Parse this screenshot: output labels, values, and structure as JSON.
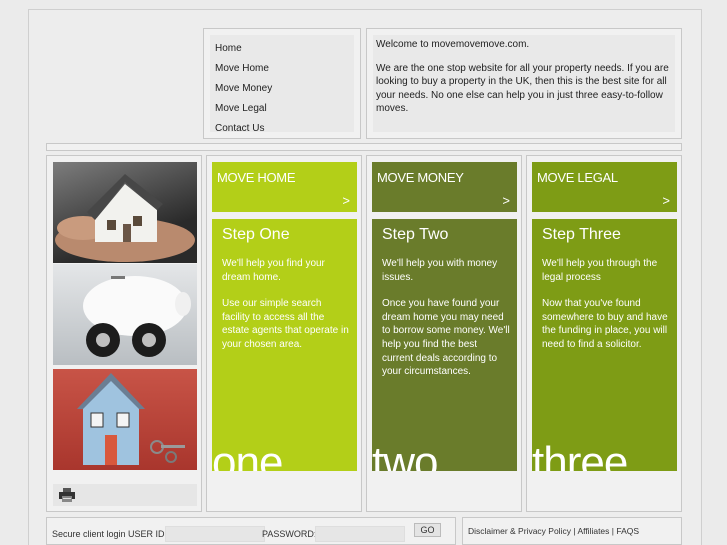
{
  "nav": {
    "items": [
      "Home",
      "Move Home",
      "Move Money",
      "Move Legal",
      "Contact Us"
    ]
  },
  "welcome": {
    "heading": "Welcome to movemovemove.com.",
    "body": "We are the one stop website for all your property needs. If you are looking to buy a property in the UK, then this is the best site for all your needs. No one else can help you in just three easy-to-follow moves."
  },
  "steps": [
    {
      "header": "MOVE HOME",
      "arrow": ">",
      "title": "Step One",
      "paragraphs": [
        "We'll help you find your dream home.",
        "Use our simple search facility to access all the estate agents that operate in your chosen area."
      ],
      "big": "one",
      "color": "#b3cf18"
    },
    {
      "header": "MOVE MONEY",
      "arrow": ">",
      "title": "Step Two",
      "paragraphs": [
        "We'll help you with money issues.",
        "Once you have found your dream home you may need to borrow some money. We'll help you find the best current deals according to your circumstances."
      ],
      "big": "two",
      "color": "#6a7c2b"
    },
    {
      "header": "MOVE LEGAL",
      "arrow": ">",
      "title": "Step Three",
      "paragraphs": [
        "We'll help you through the legal process",
        "Now that you've found somewhere to buy and have the funding in place, you will need to find a solicitor."
      ],
      "big": "three",
      "color": "#7e9c15"
    }
  ],
  "login": {
    "user_label": "Secure client login USER ID:",
    "user_value": "",
    "password_label": "PASSWORD:",
    "password_value": "",
    "go_label": "GO"
  },
  "footer": {
    "links": [
      "Disclaimer & Privacy Policy",
      "Affiliates",
      "FAQS"
    ],
    "separator": " | "
  },
  "icons": {
    "print": "printer-icon"
  }
}
